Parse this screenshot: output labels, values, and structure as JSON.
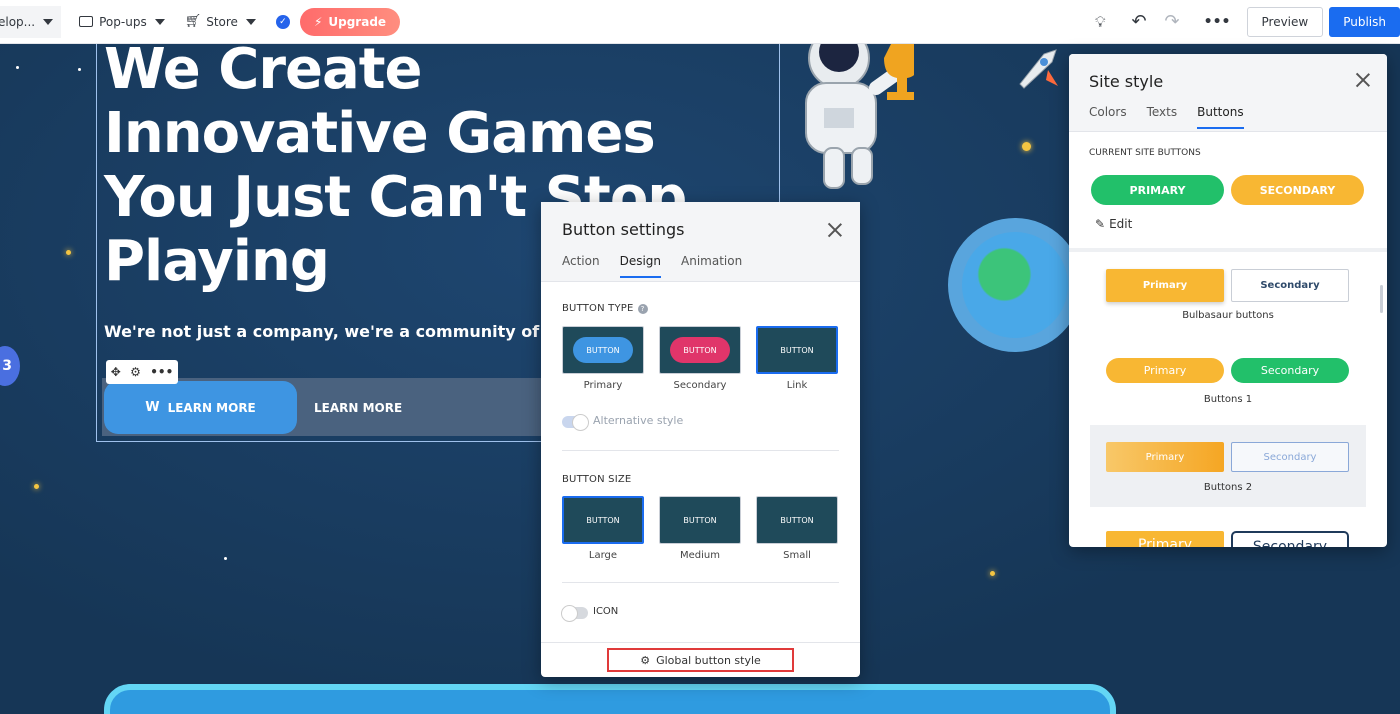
{
  "topbar": {
    "site_menu": "elop...",
    "popups": "Pop-ups",
    "store": "Store",
    "upgrade": "Upgrade",
    "preview": "Preview",
    "publish": "Publish"
  },
  "hero": {
    "title_line1": "We Create",
    "title_line2": "Innovative Games",
    "title_line3": "You Just Can't Stop",
    "title_line4": "Playing",
    "subtitle": "We're not just a company, we're a community of passic",
    "primary_button": "LEARN MORE",
    "secondary_button": "LEARN MORE",
    "side_bubble": "3"
  },
  "button_settings": {
    "title": "Button settings",
    "tabs": [
      "Action",
      "Design",
      "Animation"
    ],
    "active_tab": "Design",
    "button_type_label": "BUTTON TYPE",
    "types": [
      {
        "label": "Primary",
        "preview": "BUTTON",
        "color": "#3e95e2"
      },
      {
        "label": "Secondary",
        "preview": "BUTTON",
        "color": "#e0356a"
      },
      {
        "label": "Link",
        "preview": "BUTTON",
        "color": "#1f4a5a"
      }
    ],
    "selected_type": "Link",
    "alt_style_label": "Alternative style",
    "alt_style_on": true,
    "button_size_label": "BUTTON SIZE",
    "sizes": [
      {
        "label": "Large",
        "preview": "BUTTON"
      },
      {
        "label": "Medium",
        "preview": "BUTTON"
      },
      {
        "label": "Small",
        "preview": "BUTTON"
      }
    ],
    "selected_size": "Large",
    "icon_label": "ICON",
    "icon_on": false,
    "global_button_style": "Global button style"
  },
  "site_style": {
    "title": "Site style",
    "tabs": [
      "Colors",
      "Texts",
      "Buttons"
    ],
    "active_tab": "Buttons",
    "current_label": "CURRENT SITE BUTTONS",
    "current_primary": "PRIMARY",
    "current_secondary": "SECONDARY",
    "edit": "Edit",
    "presets": [
      {
        "name": "Bulbasaur buttons",
        "primary": "Primary",
        "secondary": "Secondary"
      },
      {
        "name": "Buttons 1",
        "primary": "Primary",
        "secondary": "Secondary"
      },
      {
        "name": "Buttons 2",
        "primary": "Primary",
        "secondary": "Secondary"
      },
      {
        "name": "",
        "primary": "Primary",
        "secondary": "Secondary"
      }
    ]
  },
  "colors": {
    "accent": "#1a6cf0",
    "green": "#22c06a",
    "yellow": "#f8b733",
    "upgrade": "#ff6b6b"
  }
}
